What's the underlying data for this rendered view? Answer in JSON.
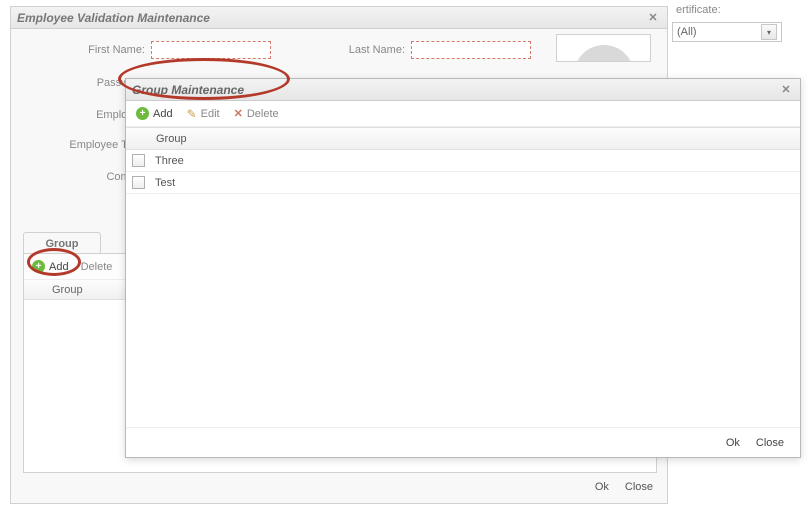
{
  "bg_window": {
    "title": "Employee Validation Maintenance",
    "labels": {
      "first_name": "First Name:",
      "last_name": "Last Name:",
      "password": "Password",
      "employee": "Employee",
      "employee_type": "Employee Type",
      "comme": "Comme"
    },
    "group_tab": "Group",
    "toolbar": {
      "add": "Add",
      "delete": "Delete"
    },
    "grid_header": "Group",
    "footer_ok": "Ok",
    "footer_close": "Close"
  },
  "side": {
    "label_frag": "ertificate:",
    "combo_value": "(All)"
  },
  "dialog": {
    "title": "Group Maintenance",
    "toolbar": {
      "add": "Add",
      "edit": "Edit",
      "delete": "Delete"
    },
    "grid_header": "Group",
    "rows": [
      {
        "name": "Three"
      },
      {
        "name": "Test"
      }
    ],
    "footer_ok": "Ok",
    "footer_close": "Close"
  }
}
